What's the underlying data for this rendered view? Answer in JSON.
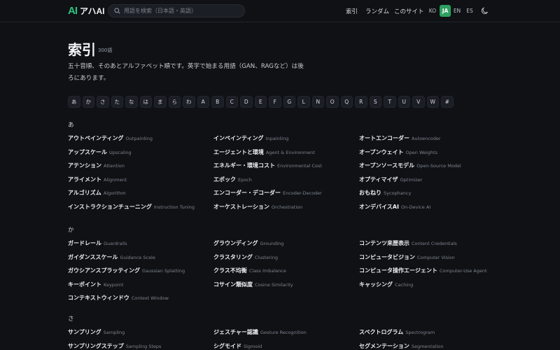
{
  "header": {
    "logo_mark": "AI",
    "logo_text": "アハAI",
    "search_placeholder": "用語を検索（日本語・英語）",
    "nav": {
      "index": "索引",
      "random": "ランダム",
      "about": "このサイト"
    },
    "langs": [
      "KO",
      "JA",
      "EN",
      "ES"
    ],
    "active_lang": "JA",
    "accent": "#2ec27e"
  },
  "page": {
    "title": "索引",
    "count": "300語",
    "description": "五十音順、そのあとアルファベット順です。英字で始まる用語（GAN、RAGなど）は後ろにあります。"
  },
  "letters": [
    "あ",
    "か",
    "さ",
    "た",
    "な",
    "は",
    "ま",
    "ら",
    "わ",
    "A",
    "B",
    "C",
    "D",
    "E",
    "F",
    "G",
    "L",
    "N",
    "O",
    "Q",
    "R",
    "S",
    "T",
    "U",
    "V",
    "W",
    "#"
  ],
  "sections": [
    {
      "heading": "あ",
      "terms": [
        {
          "ja": "アウトペインティング",
          "en": "Outpainting"
        },
        {
          "ja": "インペインティング",
          "en": "Inpainting"
        },
        {
          "ja": "オートエンコーダー",
          "en": "Autoencoder"
        },
        {
          "ja": "アップスケール",
          "en": "Upscaling"
        },
        {
          "ja": "エージェントと環境",
          "en": "Agent & Environment"
        },
        {
          "ja": "オープンウェイト",
          "en": "Open Weights"
        },
        {
          "ja": "アテンション",
          "en": "Attention"
        },
        {
          "ja": "エネルギー・環境コスト",
          "en": "Environmental Cost"
        },
        {
          "ja": "オープンソースモデル",
          "en": "Open-Source Model"
        },
        {
          "ja": "アライメント",
          "en": "Alignment"
        },
        {
          "ja": "エポック",
          "en": "Epoch"
        },
        {
          "ja": "オプティマイザ",
          "en": "Optimizer"
        },
        {
          "ja": "アルゴリズム",
          "en": "Algorithm"
        },
        {
          "ja": "エンコーダー・デコーダー",
          "en": "Encoder-Decoder"
        },
        {
          "ja": "おもねり",
          "en": "Sycophancy"
        },
        {
          "ja": "インストラクションチューニング",
          "en": "Instruction Tuning"
        },
        {
          "ja": "オーケストレーション",
          "en": "Orchestration"
        },
        {
          "ja": "オンデバイスAI",
          "en": "On-Device AI"
        }
      ]
    },
    {
      "heading": "か",
      "terms": [
        {
          "ja": "ガードレール",
          "en": "Guardrails"
        },
        {
          "ja": "グラウンディング",
          "en": "Grounding"
        },
        {
          "ja": "コンテンツ来歴表示",
          "en": "Content Credentials"
        },
        {
          "ja": "ガイダンススケール",
          "en": "Guidance Scale"
        },
        {
          "ja": "クラスタリング",
          "en": "Clustering"
        },
        {
          "ja": "コンピュータビジョン",
          "en": "Computer Vision"
        },
        {
          "ja": "ガウシアンスプラッティング",
          "en": "Gaussian Splatting"
        },
        {
          "ja": "クラス不均衡",
          "en": "Class Imbalance"
        },
        {
          "ja": "コンピュータ操作エージェント",
          "en": "Computer-Use Agent"
        },
        {
          "ja": "キーポイント",
          "en": "Keypoint"
        },
        {
          "ja": "コサイン類似度",
          "en": "Cosine Similarity"
        },
        {
          "ja": "キャッシング",
          "en": "Caching"
        },
        {
          "ja": "コンテキストウィンドウ",
          "en": "Context Window"
        }
      ]
    },
    {
      "heading": "さ",
      "terms": [
        {
          "ja": "サンプリング",
          "en": "Sampling"
        },
        {
          "ja": "ジェスチャー認識",
          "en": "Gesture Recognition"
        },
        {
          "ja": "スペクトログラム",
          "en": "Spectrogram"
        },
        {
          "ja": "サンプリングステップ",
          "en": "Sampling Steps"
        },
        {
          "ja": "シグモイド",
          "en": "Sigmoid"
        },
        {
          "ja": "セグメンテーション",
          "en": "Segmentation"
        }
      ]
    }
  ]
}
